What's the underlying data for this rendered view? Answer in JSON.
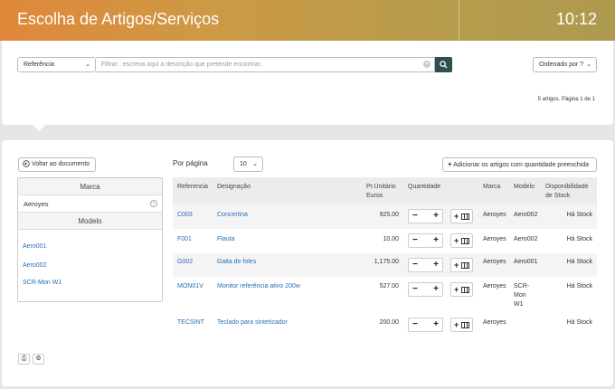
{
  "header": {
    "title": "Escolha de Artigos/Serviços",
    "clock": "10:12"
  },
  "search": {
    "field_select": "Referência",
    "placeholder": "Filtrar : escreva aqui a descrição que pretende encontrar.",
    "order_select": "Ordenado por ?"
  },
  "results_info": "5 artigos. Página 1 de 1",
  "left": {
    "back_label": "Voltar ao documento",
    "marca_header": "Marca",
    "marca_value": "Aeroyes",
    "modelo_header": "Modelo",
    "modelos": [
      "Aero001",
      "Aero002",
      "SCR-Mon W1"
    ]
  },
  "toolbar": {
    "per_page_label": "Por página",
    "per_page_value": "10",
    "add_filled_label": "Adicionar os artigos com quantidade preenchida"
  },
  "table": {
    "headers": {
      "ref": "Referencia",
      "desig": "Designação",
      "price_1": "Pr.Unitário",
      "price_2": "Euros",
      "qty": "Quantidade",
      "marca": "Marca",
      "modelo": "Modelo",
      "disp_1": "Disponibilidade",
      "disp_2": "de Stock"
    },
    "rows": [
      {
        "ref": "C003",
        "desig": "Concertina",
        "price": "925.00",
        "marca": "Aeroyes",
        "modelo": [
          "Aero002"
        ],
        "stock": "Há Stock"
      },
      {
        "ref": "F001",
        "desig": "Flauta",
        "price": "10.00",
        "marca": "Aeroyes",
        "modelo": [
          "Aero002"
        ],
        "stock": "Há Stock"
      },
      {
        "ref": "G002",
        "desig": "Gaita de foles",
        "price": "1,175.00",
        "marca": "Aeroyes",
        "modelo": [
          "Aero001"
        ],
        "stock": "Há Stock"
      },
      {
        "ref": "MON01V",
        "desig": "Monitor referência ativo 200w",
        "price": "527.00",
        "marca": "Aeroyes",
        "modelo": [
          "SCR-",
          "Mon",
          "W1"
        ],
        "stock": "Há Stock"
      },
      {
        "ref": "TECSINT",
        "desig": "Teclado para sintetizador",
        "price": "200.00",
        "marca": "Aeroyes",
        "modelo": [],
        "stock": "Há Stock"
      }
    ],
    "qty_minus": "−",
    "qty_plus": "+"
  },
  "icons": [
    "search-icon",
    "back-arrow-icon",
    "plus-icon",
    "print-icon",
    "gear-icon",
    "chevron-down-icon",
    "clear-icon",
    "add-to-list-icon"
  ]
}
